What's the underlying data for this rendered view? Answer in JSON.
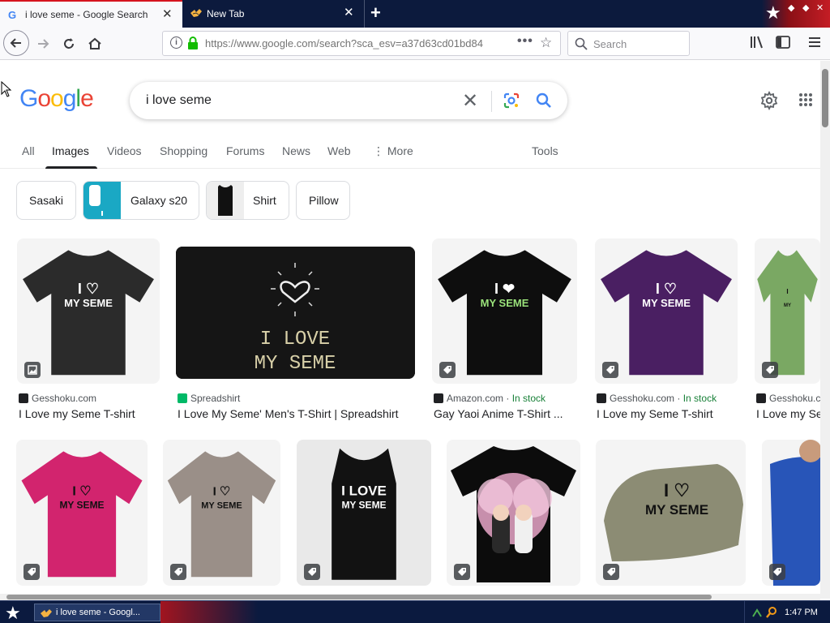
{
  "browser": {
    "tabs": [
      {
        "title": "i love seme - Google Search",
        "active": true
      },
      {
        "title": "New Tab",
        "active": false
      }
    ],
    "url_host": "https://www.google.com",
    "url_path": "/search?sca_esv=a37d63cd01bd84",
    "search_placeholder": "Search"
  },
  "google": {
    "logo": [
      "G",
      "o",
      "o",
      "g",
      "l",
      "e"
    ],
    "logo_colors": [
      "#4285f4",
      "#ea4335",
      "#fbbc05",
      "#4285f4",
      "#34a853",
      "#ea4335"
    ],
    "query": "i love seme",
    "tabs": [
      "All",
      "Images",
      "Videos",
      "Shopping",
      "Forums",
      "News",
      "Web",
      "More",
      "Tools"
    ],
    "active_tab": "Images",
    "chips": [
      "Sasaki",
      "Galaxy s20",
      "Shirt",
      "Pillow"
    ]
  },
  "results_row1": [
    {
      "source": "Gesshoku.com",
      "instock": "",
      "title": "I Love my Seme T-shirt",
      "shirt_color": "#2b2b2b",
      "text": [
        "I ♡",
        "MY SEME"
      ]
    },
    {
      "source": "Spreadshirt",
      "instock": "",
      "title": "I Love My Seme' Men's T-Shirt | Spreadshirt",
      "shirt_color": "#1f1f1f",
      "text": [
        "I LOVE",
        "MY SEME"
      ]
    },
    {
      "source": "Amazon.com",
      "instock": "In stock",
      "title": "Gay Yaoi Anime T-Shirt ...",
      "shirt_color": "#0e0e0e",
      "text": [
        "I ❤",
        "MY SEME"
      ]
    },
    {
      "source": "Gesshoku.com",
      "instock": "In stock",
      "title": "I Love my Seme T-shirt",
      "shirt_color": "#4a1f62",
      "text": [
        "I ♡",
        "MY SEME"
      ]
    },
    {
      "source": "Gesshoku.com",
      "instock": "",
      "title": "I Love my Se",
      "shirt_color": "#7aa863",
      "text": [
        "I",
        "MY"
      ]
    }
  ],
  "results_row2": [
    {
      "shirt_color": "#d2246e",
      "text": [
        "I ♡",
        "MY SEME"
      ]
    },
    {
      "shirt_color": "#9a8f88",
      "text": [
        "I ♡",
        "MY SEME"
      ]
    },
    {
      "shirt_color": "#121212",
      "text": [
        "I LOVE",
        "MY SEME"
      ]
    },
    {
      "shirt_color": "#0c0c0c",
      "text": [
        "",
        ""
      ]
    },
    {
      "shirt_color": "#8c8c74",
      "text": [
        "I ♡",
        "MY SEME"
      ]
    },
    {
      "shirt_color": "#2855b8",
      "text": [
        "",
        ""
      ]
    }
  ],
  "taskbar": {
    "item": "i love seme - Googl...",
    "clock": "1:47 PM"
  }
}
